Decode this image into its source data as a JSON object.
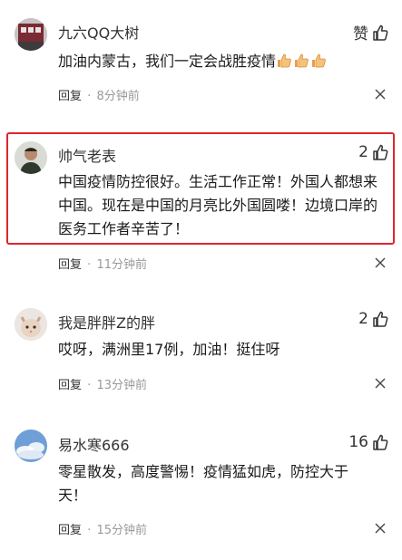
{
  "comments": [
    {
      "author": "九六QQ大树",
      "like_label": "赞",
      "text": "加油内蒙古，我们一定会战胜疫情",
      "emoji": [
        "thumbs-up",
        "thumbs-up",
        "thumbs-up"
      ],
      "reply_label": "回复",
      "separator": "·",
      "time": "8分钟前"
    },
    {
      "author": "帅气老表",
      "like_count": "2",
      "text": "中国疫情防控很好。生活工作正常！外国人都想来中国。现在是中国的月亮比外国圆喽！边境口岸的医务工作者辛苦了！",
      "reply_label": "回复",
      "separator": "·",
      "time": "11分钟前",
      "highlighted": true
    },
    {
      "author": "我是胖胖Z的胖",
      "like_count": "2",
      "text": "哎呀，满洲里17例，加油！挺住呀",
      "reply_label": "回复",
      "separator": "·",
      "time": "13分钟前"
    },
    {
      "author": "易水寒666",
      "like_count": "16",
      "text": "零星散发，高度警惕！疫情猛如虎，防控大于天！",
      "reply_label": "回复",
      "separator": "·",
      "time": "15分钟前"
    }
  ],
  "colors": {
    "highlight_border": "#e0252b",
    "meta_time": "#999999"
  }
}
